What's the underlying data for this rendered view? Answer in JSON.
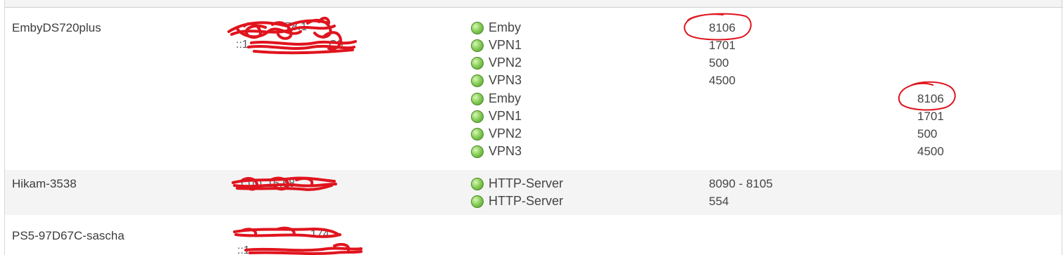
{
  "devices": [
    {
      "name": "EmbyDS720plus",
      "ip_fragments": [
        "78.1",
        "::1",
        "C3"
      ],
      "services": [
        {
          "label": "Emby",
          "port": "8106",
          "column": "ipv4"
        },
        {
          "label": "VPN1",
          "port": "1701",
          "column": "ipv4"
        },
        {
          "label": "VPN2",
          "port": "500",
          "column": "ipv4"
        },
        {
          "label": "VPN3",
          "port": "4500",
          "column": "ipv4"
        },
        {
          "label": "Emby",
          "port": "8106",
          "column": "ipv6"
        },
        {
          "label": "VPN1",
          "port": "1701",
          "column": "ipv6"
        },
        {
          "label": "VPN2",
          "port": "500",
          "column": "ipv6"
        },
        {
          "label": "VPN3",
          "port": "4500",
          "column": "ipv6"
        }
      ]
    },
    {
      "name": "Hikam-3538",
      "ip_fragments": [
        "1.0.1.15.58"
      ],
      "services": [
        {
          "label": "HTTP-Server",
          "port": "8090 - 8105",
          "column": "ipv4"
        },
        {
          "label": "HTTP-Server",
          "port": "554",
          "column": "ipv4"
        }
      ]
    },
    {
      "name": "PS5-97D67C-sascha",
      "ip_fragments": [
        "174",
        "::1"
      ],
      "services": []
    }
  ],
  "colors": {
    "led_green": "#7cc350",
    "row_alt": "#f4f4f4",
    "scribble_red": "#e0141e"
  },
  "icons": {
    "status": "green-status-led-icon"
  }
}
